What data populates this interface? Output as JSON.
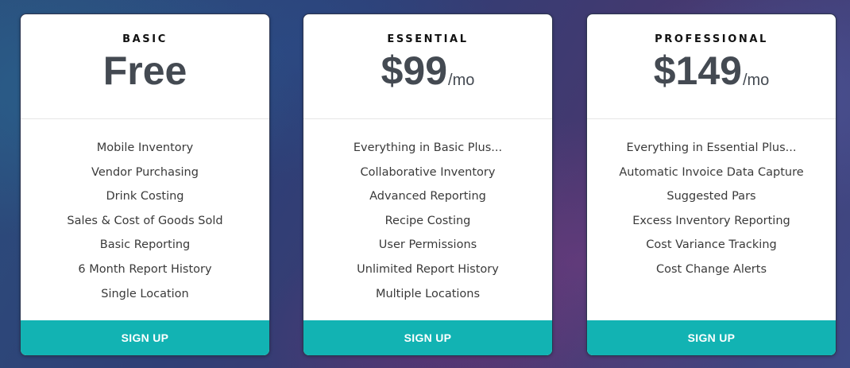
{
  "plans": [
    {
      "tier": "BASIC",
      "price": "Free",
      "per": "",
      "features": [
        "Mobile Inventory",
        "Vendor Purchasing",
        "Drink Costing",
        "Sales & Cost of Goods Sold",
        "Basic Reporting",
        "6 Month Report History",
        "Single Location"
      ],
      "cta": "SIGN UP"
    },
    {
      "tier": "ESSENTIAL",
      "price": "$99",
      "per": "/mo",
      "features": [
        "Everything in Basic Plus...",
        "Collaborative Inventory",
        "Advanced Reporting",
        "Recipe Costing",
        "User Permissions",
        "Unlimited Report History",
        "Multiple Locations"
      ],
      "cta": "SIGN UP"
    },
    {
      "tier": "PROFESSIONAL",
      "price": "$149",
      "per": "/mo",
      "features": [
        "Everything in Essential Plus...",
        "Automatic Invoice Data Capture",
        "Suggested Pars",
        "Excess Inventory Reporting",
        "Cost Variance Tracking",
        "Cost Change Alerts"
      ],
      "cta": "SIGN UP"
    }
  ],
  "colors": {
    "accent": "#12b3b3",
    "price_text": "#444a52",
    "card_bg": "#ffffff"
  }
}
